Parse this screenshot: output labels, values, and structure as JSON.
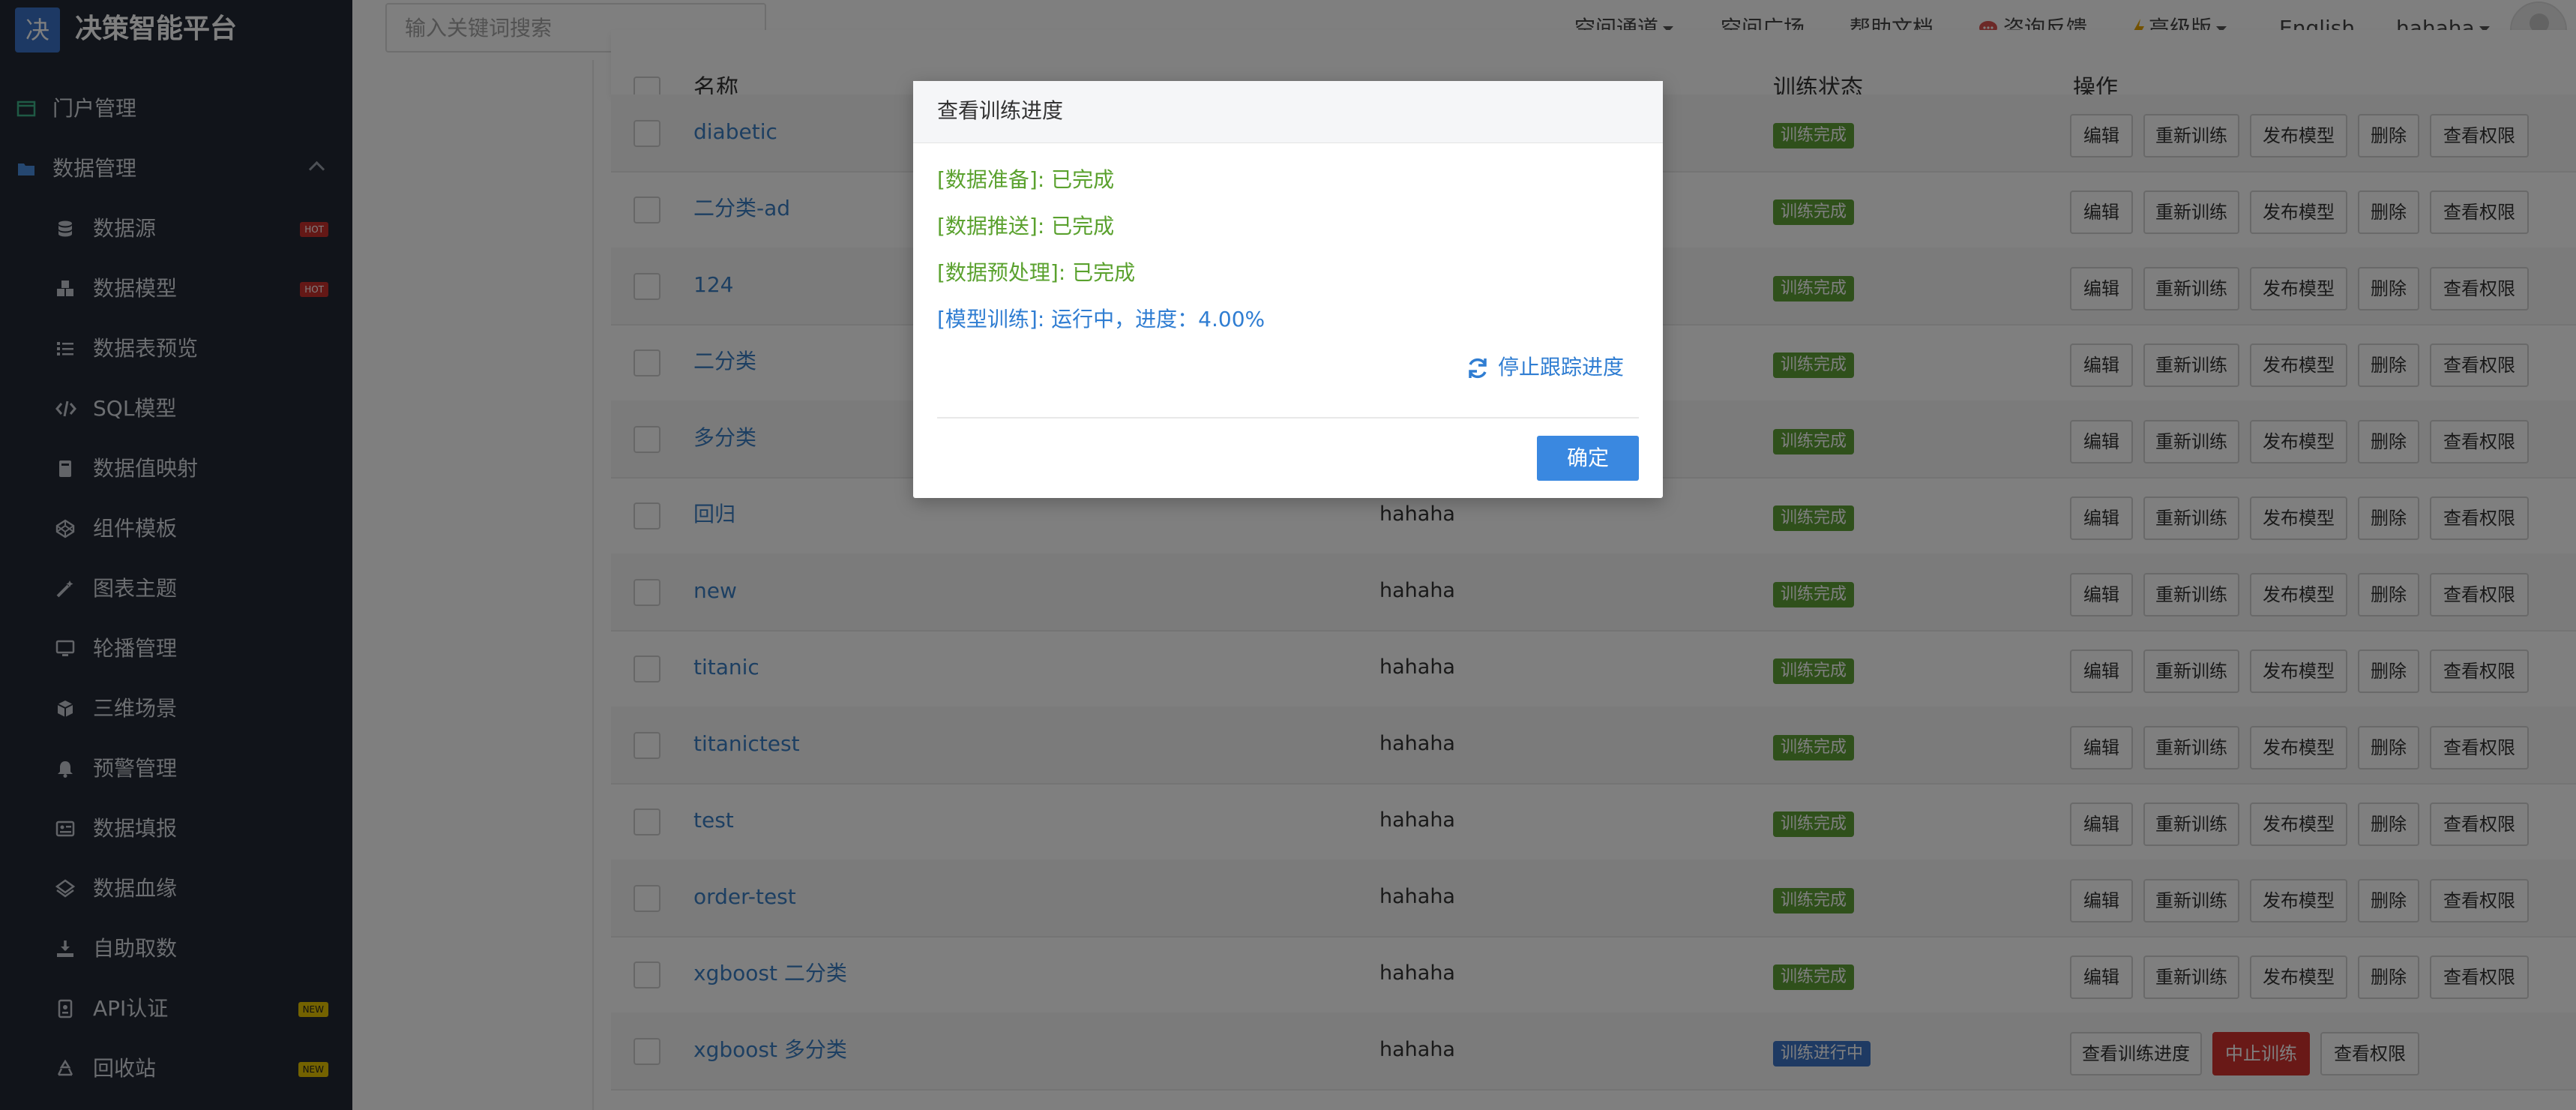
{
  "brand": {
    "logo_char": "决",
    "name": "决策智能平台"
  },
  "sidebar": {
    "items": [
      {
        "label": "门户管理",
        "icon": "portal-icon",
        "level": "top"
      },
      {
        "label": "数据管理",
        "icon": "folder-icon",
        "level": "top",
        "expanded": true
      },
      {
        "label": "数据源",
        "icon": "database-icon",
        "level": "sub",
        "badge": "HOT"
      },
      {
        "label": "数据模型",
        "icon": "cubes-icon",
        "level": "sub",
        "badge": "HOT"
      },
      {
        "label": "数据表预览",
        "icon": "list-icon",
        "level": "sub"
      },
      {
        "label": "SQL模型",
        "icon": "code-icon",
        "level": "sub"
      },
      {
        "label": "数据值映射",
        "icon": "book-icon",
        "level": "sub"
      },
      {
        "label": "组件模板",
        "icon": "codepen-icon",
        "level": "sub"
      },
      {
        "label": "图表主题",
        "icon": "magic-icon",
        "level": "sub"
      },
      {
        "label": "轮播管理",
        "icon": "monitor-icon",
        "level": "sub"
      },
      {
        "label": "三维场景",
        "icon": "cube-icon",
        "level": "sub"
      },
      {
        "label": "预警管理",
        "icon": "bell-icon",
        "level": "sub"
      },
      {
        "label": "数据填报",
        "icon": "id-card-icon",
        "level": "sub"
      },
      {
        "label": "数据血缘",
        "icon": "layers-icon",
        "level": "sub"
      },
      {
        "label": "自助取数",
        "icon": "download-icon",
        "level": "sub"
      },
      {
        "label": "API认证",
        "icon": "badge-icon",
        "level": "sub",
        "badge": "NEW"
      },
      {
        "label": "回收站",
        "icon": "recycle-icon",
        "level": "sub",
        "badge": "NEW"
      }
    ]
  },
  "topbar": {
    "search_placeholder": "输入关键词搜索",
    "links": {
      "space_channel": "空间通道",
      "space_square": "空间广场",
      "help_docs": "帮助文档",
      "feedback": "咨询反馈",
      "advanced": "高级版",
      "language": "English",
      "user": "hahaha"
    }
  },
  "table": {
    "headers": {
      "name": "名称",
      "status": "训练状态",
      "actions": "操作"
    },
    "action_labels": {
      "edit": "编辑",
      "retrain": "重新训练",
      "publish": "发布模型",
      "delete": "删除",
      "view_permission": "查看权限",
      "view_progress": "查看训练进度",
      "stop_training": "中止训练"
    },
    "rows": [
      {
        "name": "diabetic",
        "owner": "",
        "status": "训练完成",
        "state": "done"
      },
      {
        "name": "二分类-ad",
        "owner": "",
        "status": "训练完成",
        "state": "done"
      },
      {
        "name": "124",
        "owner": "",
        "status": "训练完成",
        "state": "done"
      },
      {
        "name": "二分类",
        "owner": "",
        "status": "训练完成",
        "state": "done"
      },
      {
        "name": "多分类",
        "owner": "",
        "status": "训练完成",
        "state": "done"
      },
      {
        "name": "回归",
        "owner": "hahaha",
        "status": "训练完成",
        "state": "done"
      },
      {
        "name": "new",
        "owner": "hahaha",
        "status": "训练完成",
        "state": "done"
      },
      {
        "name": "titanic",
        "owner": "hahaha",
        "status": "训练完成",
        "state": "done"
      },
      {
        "name": "titanictest",
        "owner": "hahaha",
        "status": "训练完成",
        "state": "done"
      },
      {
        "name": "test",
        "owner": "hahaha",
        "status": "训练完成",
        "state": "done"
      },
      {
        "name": "order-test",
        "owner": "hahaha",
        "status": "训练完成",
        "state": "done"
      },
      {
        "name": "xgboost 二分类",
        "owner": "hahaha",
        "status": "训练完成",
        "state": "done"
      },
      {
        "name": "xgboost 多分类",
        "owner": "hahaha",
        "status": "训练进行中",
        "state": "running"
      }
    ]
  },
  "modal": {
    "title": "查看训练进度",
    "progress": [
      {
        "text": "[数据准备]: 已完成",
        "state": "done"
      },
      {
        "text": "[数据推送]: 已完成",
        "state": "done"
      },
      {
        "text": "[数据预处理]: 已完成",
        "state": "done"
      },
      {
        "text": "[模型训练]: 运行中，进度：4.00%",
        "state": "running"
      }
    ],
    "stop_tracking": "停止跟踪进度",
    "confirm": "确定"
  },
  "colors": {
    "sidebar_bg": "#222834",
    "link_blue": "#3b7fc4",
    "status_done": "#5fa036",
    "status_running": "#3d75c6",
    "danger": "#d3322f",
    "primary_button": "#3a88e0",
    "hot_badge": "#c9302c",
    "new_badge": "#e7c400"
  }
}
